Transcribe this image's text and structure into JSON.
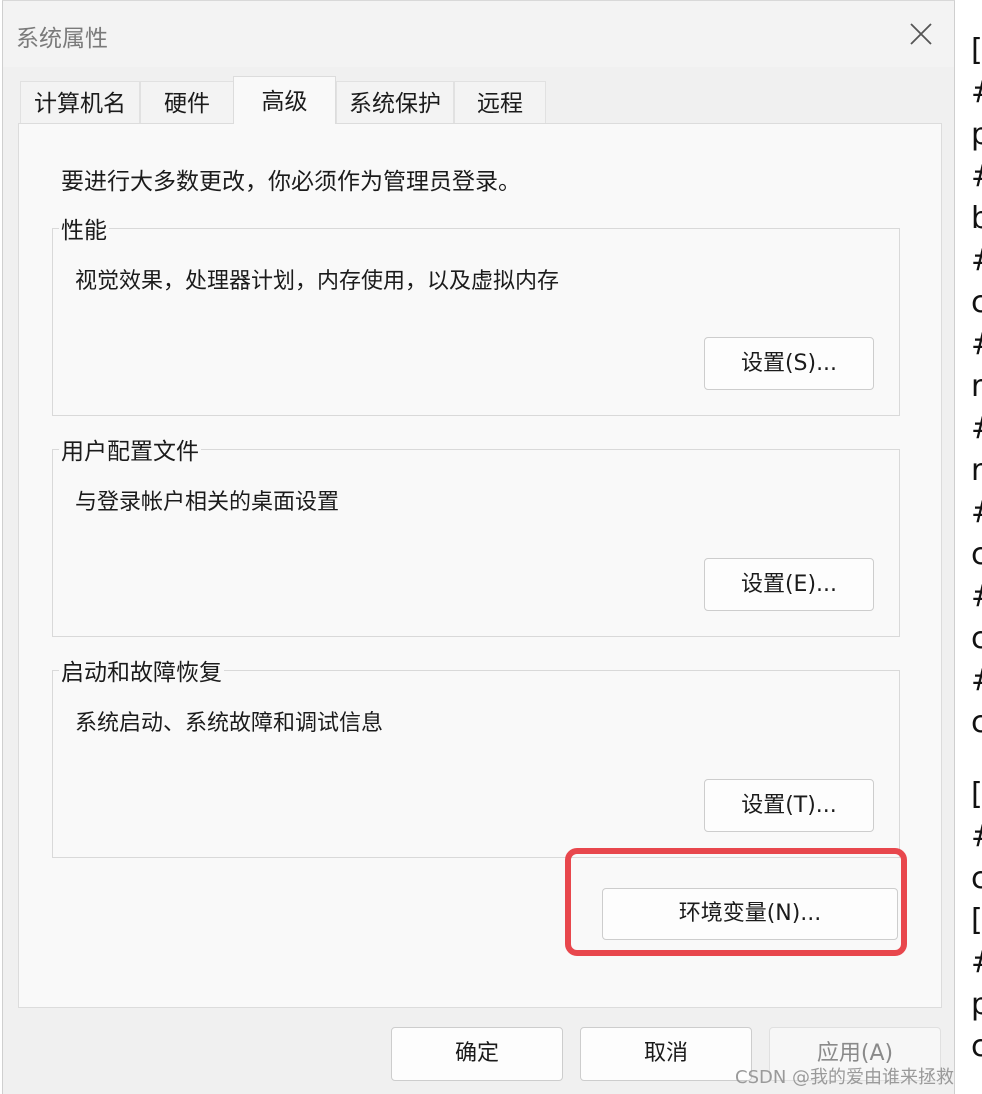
{
  "window": {
    "title": "系统属性"
  },
  "tabs": [
    {
      "label": "计算机名",
      "active": false
    },
    {
      "label": "硬件",
      "active": false
    },
    {
      "label": "高级",
      "active": true
    },
    {
      "label": "系统保护",
      "active": false
    },
    {
      "label": "远程",
      "active": false
    }
  ],
  "advanced": {
    "notice": "要进行大多数更改，你必须作为管理员登录。",
    "performance": {
      "title": "性能",
      "description": "视觉效果，处理器计划，内存使用，以及虚拟内存",
      "button": "设置(S)..."
    },
    "user_profiles": {
      "title": "用户配置文件",
      "description": "与登录帐户相关的桌面设置",
      "button": "设置(E)..."
    },
    "startup_recovery": {
      "title": "启动和故障恢复",
      "description": "系统启动、系统故障和调试信息",
      "button": "设置(T)..."
    },
    "env_button": "环境变量(N)..."
  },
  "footer": {
    "ok": "确定",
    "cancel": "取消",
    "apply": "应用(A)"
  },
  "background_text": [
    "[",
    "#",
    "p",
    "#",
    "b",
    "#",
    "c",
    "#",
    "r",
    "#",
    "r",
    "#",
    "c",
    "#",
    "c",
    "#",
    "c",
    "",
    "[",
    "#",
    "c",
    "[",
    "#",
    "p",
    "c"
  ],
  "watermark": "CSDN @我的爱由谁来拯救",
  "colors": {
    "highlight": "#e8474d",
    "dialog_bg": "#f0f0f0",
    "panel_bg": "#f9f9f9"
  }
}
